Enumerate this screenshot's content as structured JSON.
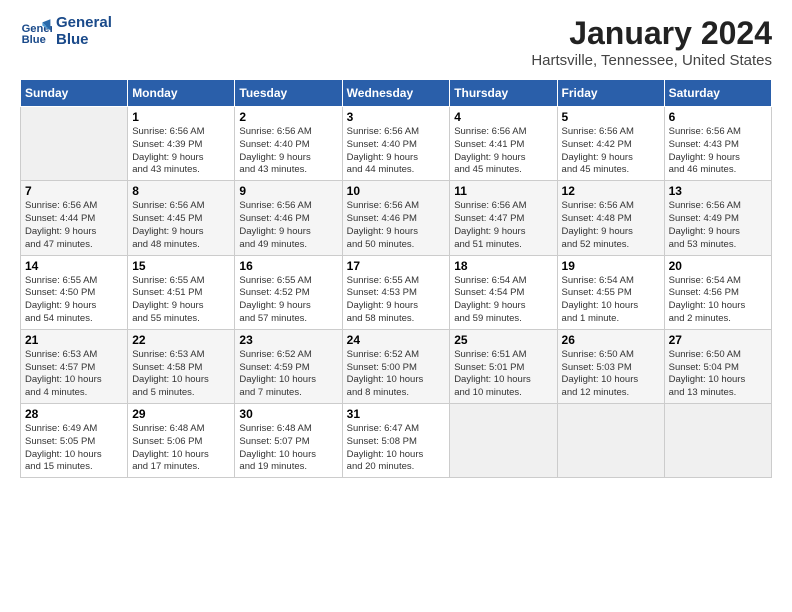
{
  "header": {
    "logo_text_general": "General",
    "logo_text_blue": "Blue",
    "title": "January 2024",
    "location": "Hartsville, Tennessee, United States"
  },
  "calendar": {
    "days_of_week": [
      "Sunday",
      "Monday",
      "Tuesday",
      "Wednesday",
      "Thursday",
      "Friday",
      "Saturday"
    ],
    "weeks": [
      [
        {
          "day": "",
          "empty": true
        },
        {
          "day": "1",
          "sunrise": "6:56 AM",
          "sunset": "4:39 PM",
          "daylight": "9 hours and 43 minutes."
        },
        {
          "day": "2",
          "sunrise": "6:56 AM",
          "sunset": "4:40 PM",
          "daylight": "9 hours and 43 minutes."
        },
        {
          "day": "3",
          "sunrise": "6:56 AM",
          "sunset": "4:40 PM",
          "daylight": "9 hours and 44 minutes."
        },
        {
          "day": "4",
          "sunrise": "6:56 AM",
          "sunset": "4:41 PM",
          "daylight": "9 hours and 45 minutes."
        },
        {
          "day": "5",
          "sunrise": "6:56 AM",
          "sunset": "4:42 PM",
          "daylight": "9 hours and 45 minutes."
        },
        {
          "day": "6",
          "sunrise": "6:56 AM",
          "sunset": "4:43 PM",
          "daylight": "9 hours and 46 minutes."
        }
      ],
      [
        {
          "day": "7",
          "sunrise": "6:56 AM",
          "sunset": "4:44 PM",
          "daylight": "9 hours and 47 minutes."
        },
        {
          "day": "8",
          "sunrise": "6:56 AM",
          "sunset": "4:45 PM",
          "daylight": "9 hours and 48 minutes."
        },
        {
          "day": "9",
          "sunrise": "6:56 AM",
          "sunset": "4:46 PM",
          "daylight": "9 hours and 49 minutes."
        },
        {
          "day": "10",
          "sunrise": "6:56 AM",
          "sunset": "4:46 PM",
          "daylight": "9 hours and 50 minutes."
        },
        {
          "day": "11",
          "sunrise": "6:56 AM",
          "sunset": "4:47 PM",
          "daylight": "9 hours and 51 minutes."
        },
        {
          "day": "12",
          "sunrise": "6:56 AM",
          "sunset": "4:48 PM",
          "daylight": "9 hours and 52 minutes."
        },
        {
          "day": "13",
          "sunrise": "6:56 AM",
          "sunset": "4:49 PM",
          "daylight": "9 hours and 53 minutes."
        }
      ],
      [
        {
          "day": "14",
          "sunrise": "6:55 AM",
          "sunset": "4:50 PM",
          "daylight": "9 hours and 54 minutes."
        },
        {
          "day": "15",
          "sunrise": "6:55 AM",
          "sunset": "4:51 PM",
          "daylight": "9 hours and 55 minutes."
        },
        {
          "day": "16",
          "sunrise": "6:55 AM",
          "sunset": "4:52 PM",
          "daylight": "9 hours and 57 minutes."
        },
        {
          "day": "17",
          "sunrise": "6:55 AM",
          "sunset": "4:53 PM",
          "daylight": "9 hours and 58 minutes."
        },
        {
          "day": "18",
          "sunrise": "6:54 AM",
          "sunset": "4:54 PM",
          "daylight": "9 hours and 59 minutes."
        },
        {
          "day": "19",
          "sunrise": "6:54 AM",
          "sunset": "4:55 PM",
          "daylight": "10 hours and 1 minute."
        },
        {
          "day": "20",
          "sunrise": "6:54 AM",
          "sunset": "4:56 PM",
          "daylight": "10 hours and 2 minutes."
        }
      ],
      [
        {
          "day": "21",
          "sunrise": "6:53 AM",
          "sunset": "4:57 PM",
          "daylight": "10 hours and 4 minutes."
        },
        {
          "day": "22",
          "sunrise": "6:53 AM",
          "sunset": "4:58 PM",
          "daylight": "10 hours and 5 minutes."
        },
        {
          "day": "23",
          "sunrise": "6:52 AM",
          "sunset": "4:59 PM",
          "daylight": "10 hours and 7 minutes."
        },
        {
          "day": "24",
          "sunrise": "6:52 AM",
          "sunset": "5:00 PM",
          "daylight": "10 hours and 8 minutes."
        },
        {
          "day": "25",
          "sunrise": "6:51 AM",
          "sunset": "5:01 PM",
          "daylight": "10 hours and 10 minutes."
        },
        {
          "day": "26",
          "sunrise": "6:50 AM",
          "sunset": "5:03 PM",
          "daylight": "10 hours and 12 minutes."
        },
        {
          "day": "27",
          "sunrise": "6:50 AM",
          "sunset": "5:04 PM",
          "daylight": "10 hours and 13 minutes."
        }
      ],
      [
        {
          "day": "28",
          "sunrise": "6:49 AM",
          "sunset": "5:05 PM",
          "daylight": "10 hours and 15 minutes."
        },
        {
          "day": "29",
          "sunrise": "6:48 AM",
          "sunset": "5:06 PM",
          "daylight": "10 hours and 17 minutes."
        },
        {
          "day": "30",
          "sunrise": "6:48 AM",
          "sunset": "5:07 PM",
          "daylight": "10 hours and 19 minutes."
        },
        {
          "day": "31",
          "sunrise": "6:47 AM",
          "sunset": "5:08 PM",
          "daylight": "10 hours and 20 minutes."
        },
        {
          "day": "",
          "empty": true
        },
        {
          "day": "",
          "empty": true
        },
        {
          "day": "",
          "empty": true
        }
      ]
    ]
  }
}
